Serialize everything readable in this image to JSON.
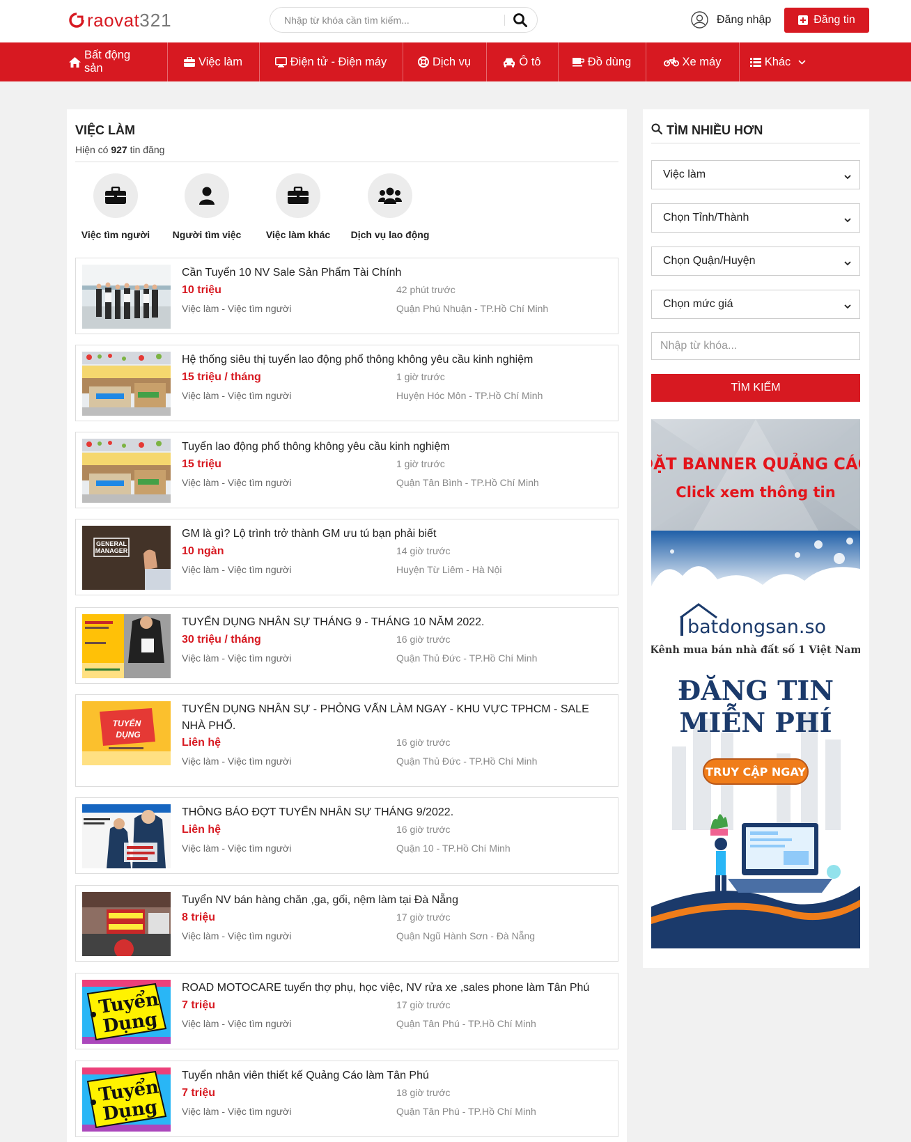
{
  "header": {
    "logo_text": "raovat",
    "logo_num": "321",
    "search_placeholder": "Nhập từ khóa cần tìm kiếm...",
    "login_label": "Đăng nhập",
    "post_label": "Đăng tin"
  },
  "nav": [
    {
      "label": "Bất động sản",
      "icon": "home-icon"
    },
    {
      "label": "Việc làm",
      "icon": "briefcase-icon"
    },
    {
      "label": "Điện tử - Điện máy",
      "icon": "monitor-icon"
    },
    {
      "label": "Dịch vụ",
      "icon": "lifebuoy-icon"
    },
    {
      "label": "Ô tô",
      "icon": "car-icon"
    },
    {
      "label": "Đồ dùng",
      "icon": "cup-icon"
    },
    {
      "label": "Xe máy",
      "icon": "motorbike-icon"
    },
    {
      "label": "Khác",
      "icon": "list-icon"
    }
  ],
  "main": {
    "title": "VIỆC LÀM",
    "count_prefix": "Hiện có",
    "count_value": "927",
    "count_suffix": "tin đăng",
    "categories": [
      {
        "label": "Việc tìm người",
        "icon": "briefcase-icon"
      },
      {
        "label": "Người tìm việc",
        "icon": "user-icon"
      },
      {
        "label": "Việc làm khác",
        "icon": "briefcase-icon"
      },
      {
        "label": "Dịch vụ lao động",
        "icon": "users-icon"
      }
    ],
    "listings": [
      {
        "title": "Cần Tuyển 10 NV Sale Sản Phẩm Tài Chính",
        "price": "10 triệu",
        "time": "42 phút trước",
        "category": "Việc làm - Việc tìm người",
        "location": "Quận Phú Nhuận - TP.Hồ Chí Minh"
      },
      {
        "title": "Hệ thống siêu thị tuyển lao động phổ thông không yêu cầu kinh nghiệm",
        "price": "15 triệu / tháng",
        "time": "1 giờ trước",
        "category": "Việc làm - Việc tìm người",
        "location": "Huyện Hóc Môn - TP.Hồ Chí Minh"
      },
      {
        "title": "Tuyển lao động phổ thông không yêu cầu kinh nghiệm",
        "price": "15 triệu",
        "time": "1 giờ trước",
        "category": "Việc làm - Việc tìm người",
        "location": "Quận Tân Bình - TP.Hồ Chí Minh"
      },
      {
        "title": "GM là gì? Lộ trình trở thành GM ưu tú bạn phải biết",
        "price": "10 ngàn",
        "time": "14 giờ trước",
        "category": "Việc làm - Việc tìm người",
        "location": "Huyện Từ Liêm - Hà Nội"
      },
      {
        "title": "TUYỂN DỤNG NHÂN SỰ THÁNG 9 - THÁNG 10 NĂM 2022.",
        "price": "30 triệu / tháng",
        "time": "16 giờ trước",
        "category": "Việc làm - Việc tìm người",
        "location": "Quận Thủ Đức - TP.Hồ Chí Minh"
      },
      {
        "title": "TUYỂN DỤNG NHÂN SỰ - PHỎNG VẤN LÀM NGAY - KHU VỰC TPHCM - SALE NHÀ PHỐ.",
        "price": "Liên hệ",
        "time": "16 giờ trước",
        "category": "Việc làm - Việc tìm người",
        "location": "Quận Thủ Đức - TP.Hồ Chí Minh"
      },
      {
        "title": "THÔNG BÁO ĐỢT TUYỂN NHÂN SỰ THÁNG 9/2022.",
        "price": "Liên hệ",
        "time": "16 giờ trước",
        "category": "Việc làm - Việc tìm người",
        "location": "Quận 10 - TP.Hồ Chí Minh"
      },
      {
        "title": "Tuyển NV bán hàng chăn ,ga, gối, nệm làm tại Đà Nẵng",
        "price": "8 triệu",
        "time": "17 giờ trước",
        "category": "Việc làm - Việc tìm người",
        "location": "Quận Ngũ Hành Sơn - Đà Nẵng"
      },
      {
        "title": "ROAD MOTOCARE tuyển thợ phụ, học việc, NV rửa xe ,sales phone làm Tân Phú",
        "price": "7 triệu",
        "time": "17 giờ trước",
        "category": "Việc làm - Việc tìm người",
        "location": "Quận Tân Phú - TP.Hồ Chí Minh"
      },
      {
        "title": "Tuyển nhân viên thiết kế Quảng Cáo làm Tân Phú",
        "price": "7 triệu",
        "time": "18 giờ trước",
        "category": "Việc làm - Việc tìm người",
        "location": "Quận Tân Phú - TP.Hồ Chí Minh"
      }
    ],
    "thumb_text": {
      "gm_line1": "GENERAL",
      "gm_line2": "MANAGER",
      "tuyen": "Tuyển",
      "dung": "Dụng",
      "tuyen_caps": "TUYỂN",
      "dung_caps": "DỤNG"
    }
  },
  "sidebar": {
    "title": "TÌM NHIỀU HƠN",
    "selects": [
      "Việc làm",
      "Chọn Tỉnh/Thành",
      "Chọn Quận/Huyện",
      "Chọn mức giá"
    ],
    "keyword_placeholder": "Nhập từ khóa...",
    "search_label": "TÌM KIẾM",
    "banner": {
      "line1": "ĐẶT BANNER QUẢNG CÁO",
      "line2": "Click xem thông tin",
      "brand": "batdongsan.so",
      "tagline": "Kênh mua bán nhà đất số 1 Việt Nam",
      "big1": "ĐĂNG TIN",
      "big2": "MIỄN PHÍ",
      "cta": "TRUY CẬP NGAY"
    }
  },
  "colors": {
    "brand_red": "#d71921",
    "navy": "#1b3a6b",
    "orange": "#f07d1a"
  }
}
